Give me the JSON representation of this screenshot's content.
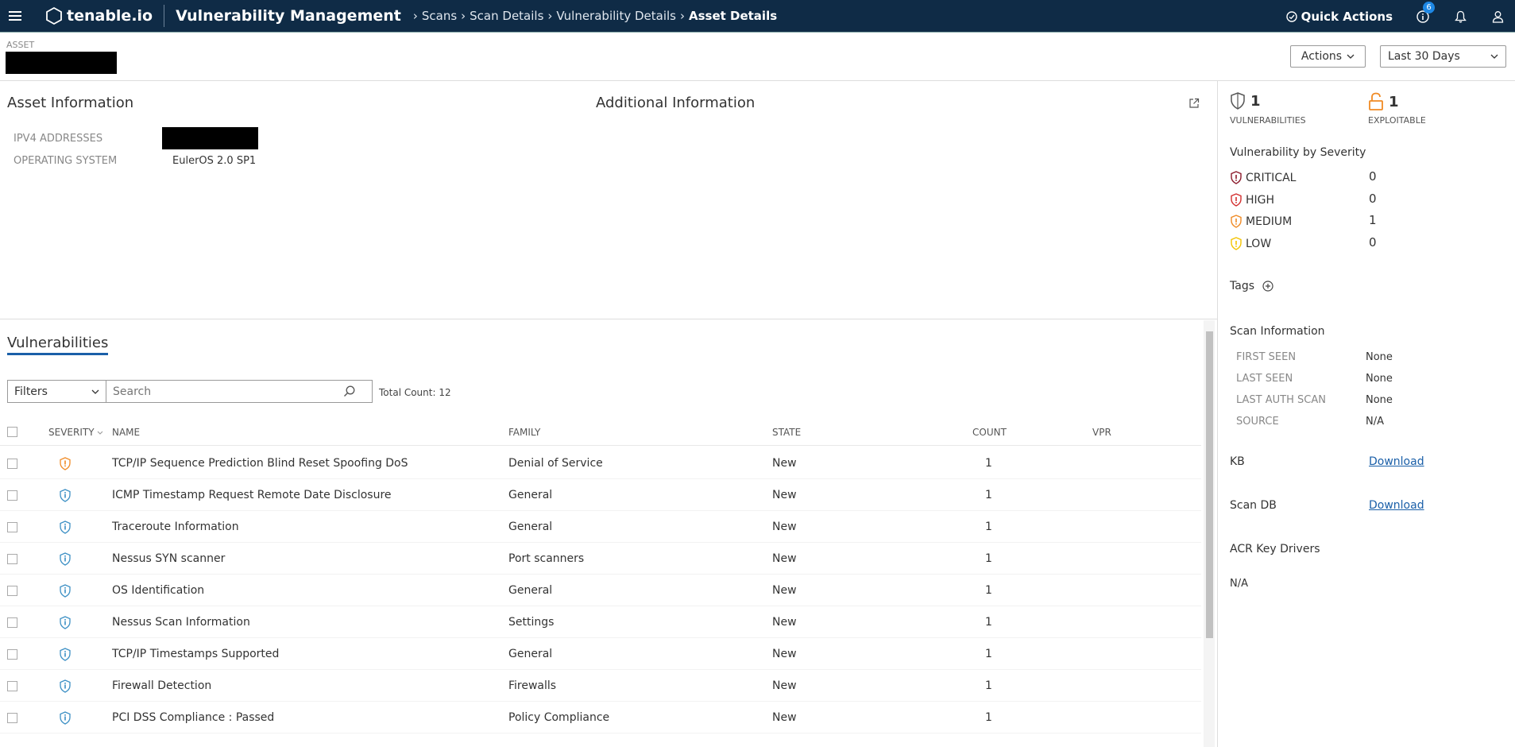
{
  "topbar": {
    "logo": "tenable.io",
    "title": "Vulnerability Management",
    "breadcrumbs": [
      "Scans",
      "Scan Details",
      "Vulnerability Details",
      "Asset Details"
    ],
    "quick_actions": "Quick Actions",
    "notification_count": "6"
  },
  "asset": {
    "label": "ASSET",
    "actions_label": "Actions",
    "date_range": "Last 30 Days"
  },
  "asset_info": {
    "title": "Asset Information",
    "fields": [
      {
        "label": "IPV4 ADDRESSES",
        "value": ""
      },
      {
        "label": "OPERATING SYSTEM",
        "value": "EulerOS 2.0 SP1"
      }
    ]
  },
  "additional_info": {
    "title": "Additional Information"
  },
  "sidebar": {
    "vulnerabilities_count": "1",
    "vulnerabilities_label": "VULNERABILITIES",
    "exploitable_count": "1",
    "exploitable_label": "EXPLOITABLE",
    "by_severity_title": "Vulnerability by Severity",
    "severities": [
      {
        "label": "CRITICAL",
        "count": "0",
        "color": "#8b1a2b"
      },
      {
        "label": "HIGH",
        "count": "0",
        "color": "#d32f2f"
      },
      {
        "label": "MEDIUM",
        "count": "1",
        "color": "#f08a24"
      },
      {
        "label": "LOW",
        "count": "0",
        "color": "#f3c300"
      }
    ],
    "tags_title": "Tags",
    "scan_info_title": "Scan Information",
    "scan_info": [
      {
        "label": "FIRST SEEN",
        "value": "None"
      },
      {
        "label": "LAST SEEN",
        "value": "None"
      },
      {
        "label": "LAST AUTH SCAN",
        "value": "None"
      },
      {
        "label": "SOURCE",
        "value": "N/A"
      }
    ],
    "kb_label": "KB",
    "kb_link": "Download",
    "scandb_label": "Scan DB",
    "scandb_link": "Download",
    "acr_title": "ACR Key Drivers",
    "acr_value": "N/A"
  },
  "vulnerabilities": {
    "tab_label": "Vulnerabilities",
    "filters_label": "Filters",
    "search_placeholder": "Search",
    "total_count": "Total Count: 12",
    "columns": {
      "severity": "SEVERITY",
      "name": "NAME",
      "family": "FAMILY",
      "state": "STATE",
      "count": "COUNT",
      "vpr": "VPR"
    },
    "rows": [
      {
        "severity": "medium",
        "name": "TCP/IP Sequence Prediction Blind Reset Spoofing DoS",
        "family": "Denial of Service",
        "state": "New",
        "count": "1"
      },
      {
        "severity": "info",
        "name": "ICMP Timestamp Request Remote Date Disclosure",
        "family": "General",
        "state": "New",
        "count": "1"
      },
      {
        "severity": "info",
        "name": "Traceroute Information",
        "family": "General",
        "state": "New",
        "count": "1"
      },
      {
        "severity": "info",
        "name": "Nessus SYN scanner",
        "family": "Port scanners",
        "state": "New",
        "count": "1"
      },
      {
        "severity": "info",
        "name": "OS Identification",
        "family": "General",
        "state": "New",
        "count": "1"
      },
      {
        "severity": "info",
        "name": "Nessus Scan Information",
        "family": "Settings",
        "state": "New",
        "count": "1"
      },
      {
        "severity": "info",
        "name": "TCP/IP Timestamps Supported",
        "family": "General",
        "state": "New",
        "count": "1"
      },
      {
        "severity": "info",
        "name": "Firewall Detection",
        "family": "Firewalls",
        "state": "New",
        "count": "1"
      },
      {
        "severity": "info",
        "name": "PCI DSS Compliance : Passed",
        "family": "Policy Compliance",
        "state": "New",
        "count": "1"
      }
    ]
  },
  "colors": {
    "topbar_bg": "#0f2b46",
    "accent": "#1a5fa8",
    "medium": "#f08a24",
    "info": "#3b8fc4"
  }
}
